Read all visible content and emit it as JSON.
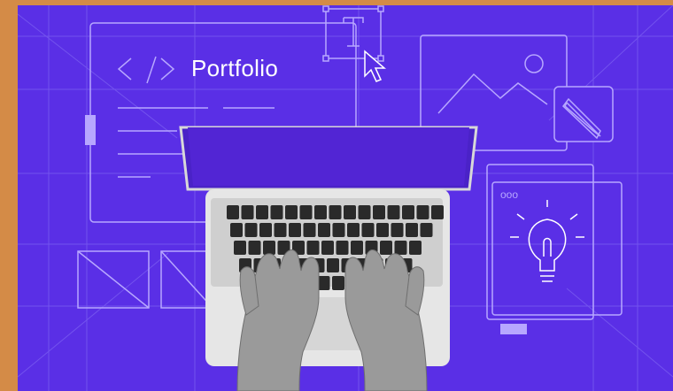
{
  "illustration": {
    "portfolio_label": "Portfolio",
    "code_symbol": "</>",
    "type_tool_letter": "T",
    "browser_dots": "ooo",
    "colors": {
      "border": "#d48b47",
      "background": "#5a2fe6",
      "line": "#b7a7ff",
      "screen": "#5225d4",
      "laptop_body": "#e6e6e6",
      "keys": "#2a2a2a"
    }
  }
}
